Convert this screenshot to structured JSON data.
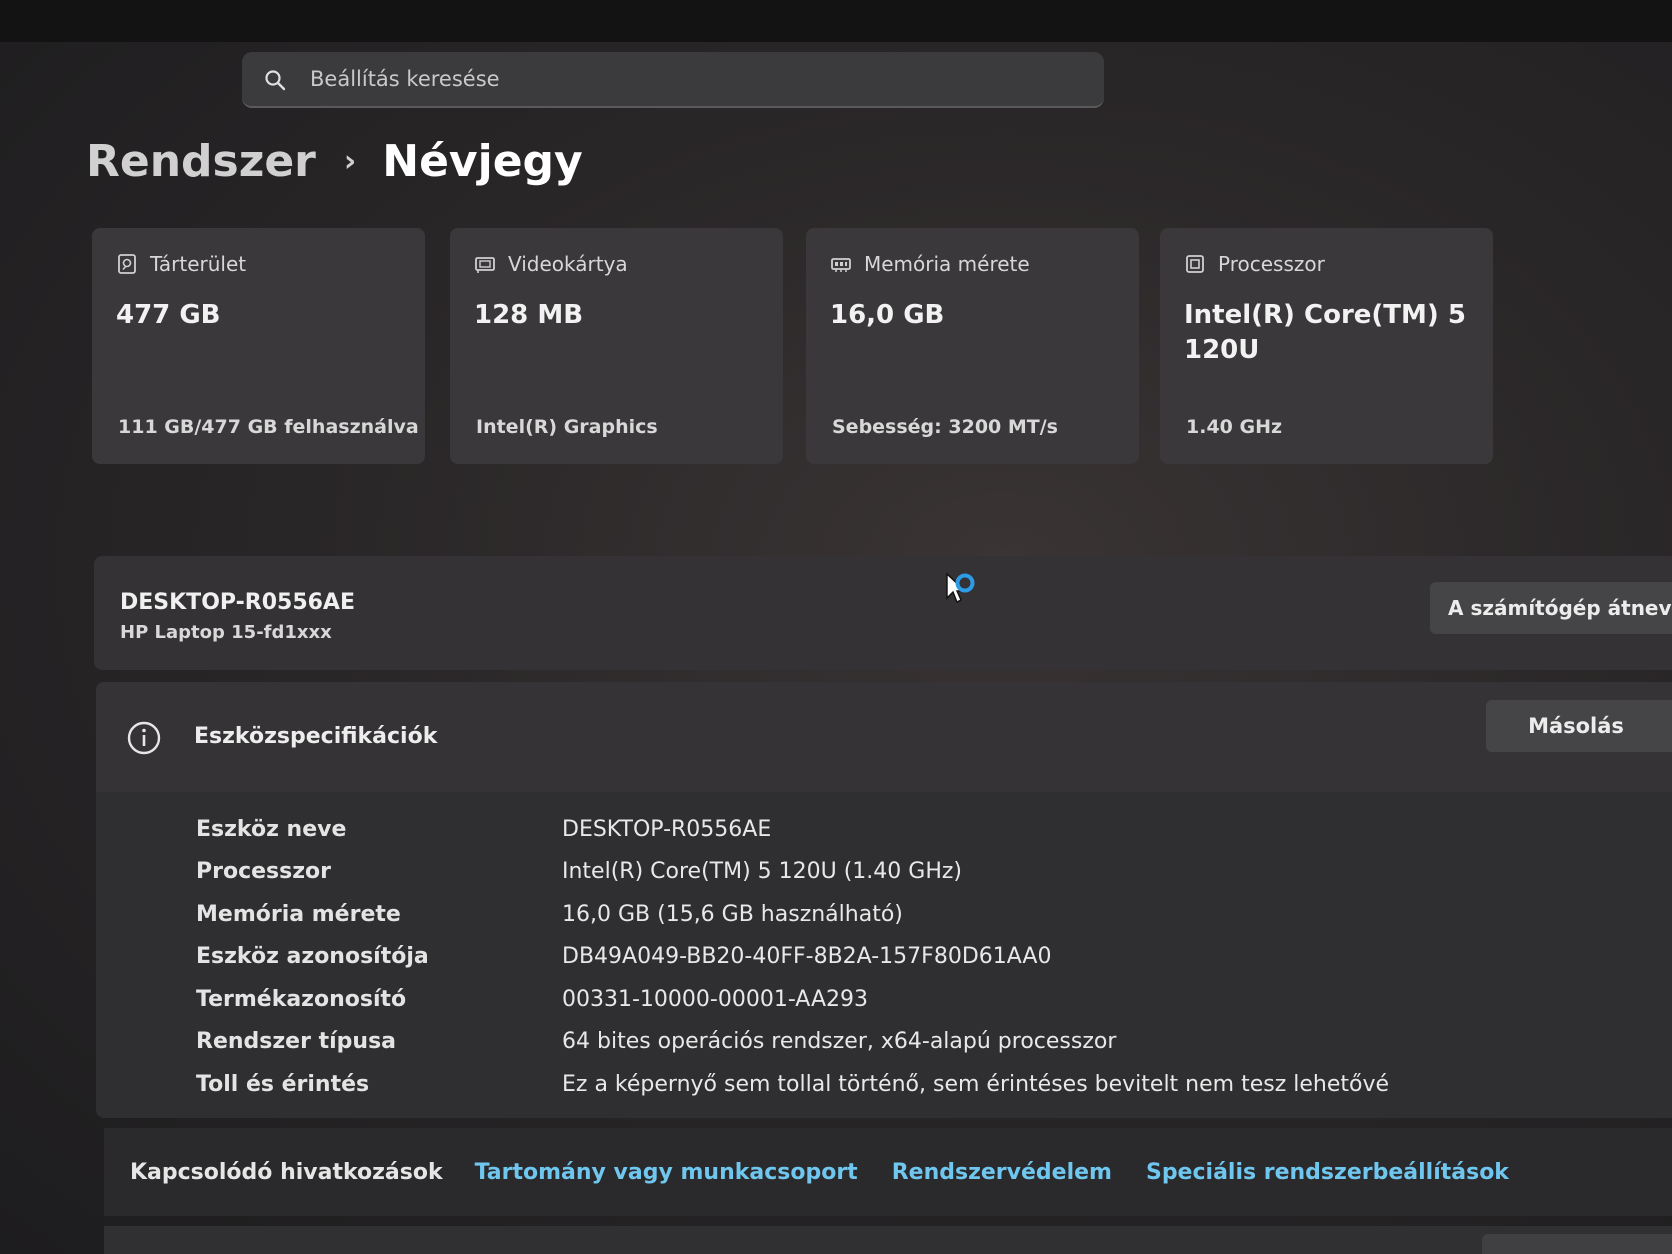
{
  "search": {
    "placeholder": "Beállítás keresése"
  },
  "breadcrumb": {
    "parent": "Rendszer",
    "separator": "›",
    "current": "Névjegy"
  },
  "cards": [
    {
      "icon": "storage-icon",
      "title": "Tárterület",
      "value": "477 GB",
      "sub": "111 GB/477 GB felhasználva"
    },
    {
      "icon": "graphics-card-icon",
      "title": "Videokártya",
      "value": "128 MB",
      "sub": "Intel(R) Graphics"
    },
    {
      "icon": "memory-icon",
      "title": "Memória mérete",
      "value": "16,0 GB",
      "sub": "Sebesség: 3200 MT/s"
    },
    {
      "icon": "processor-icon",
      "title": "Processzor",
      "value": "Intel(R) Core(TM) 5 120U",
      "sub": "1.40 GHz"
    }
  ],
  "device": {
    "name": "DESKTOP-R0556AE",
    "model": "HP Laptop 15-fd1xxx",
    "rename_label": "A számítógép átnevezése"
  },
  "specs": {
    "title": "Eszközspecifikációk",
    "copy_label": "Másolás",
    "rows": [
      {
        "label": "Eszköz neve",
        "value": "DESKTOP-R0556AE"
      },
      {
        "label": "Processzor",
        "value": "Intel(R) Core(TM) 5 120U (1.40 GHz)"
      },
      {
        "label": "Memória mérete",
        "value": "16,0 GB (15,6 GB használható)"
      },
      {
        "label": "Eszköz azonosítója",
        "value": "DB49A049-BB20-40FF-8B2A-157F80D61AA0"
      },
      {
        "label": "Termékazonosító",
        "value": "00331-10000-00001-AA293"
      },
      {
        "label": "Rendszer típusa",
        "value": "64 bites operációs rendszer, x64-alapú processzor"
      },
      {
        "label": "Toll és érintés",
        "value": "Ez a képernyő sem tollal történő, sem érintéses bevitelt nem tesz lehetővé"
      }
    ]
  },
  "related_links": {
    "label": "Kapcsolódó hivatkozások",
    "links": [
      "Tartomány vagy munkacsoport",
      "Rendszervédelem",
      "Speciális rendszerbeállítások"
    ]
  },
  "colors": {
    "accent_link": "#6fc6ef",
    "card_bg": "#3a383a",
    "busy_ring": "#2e9be6"
  }
}
